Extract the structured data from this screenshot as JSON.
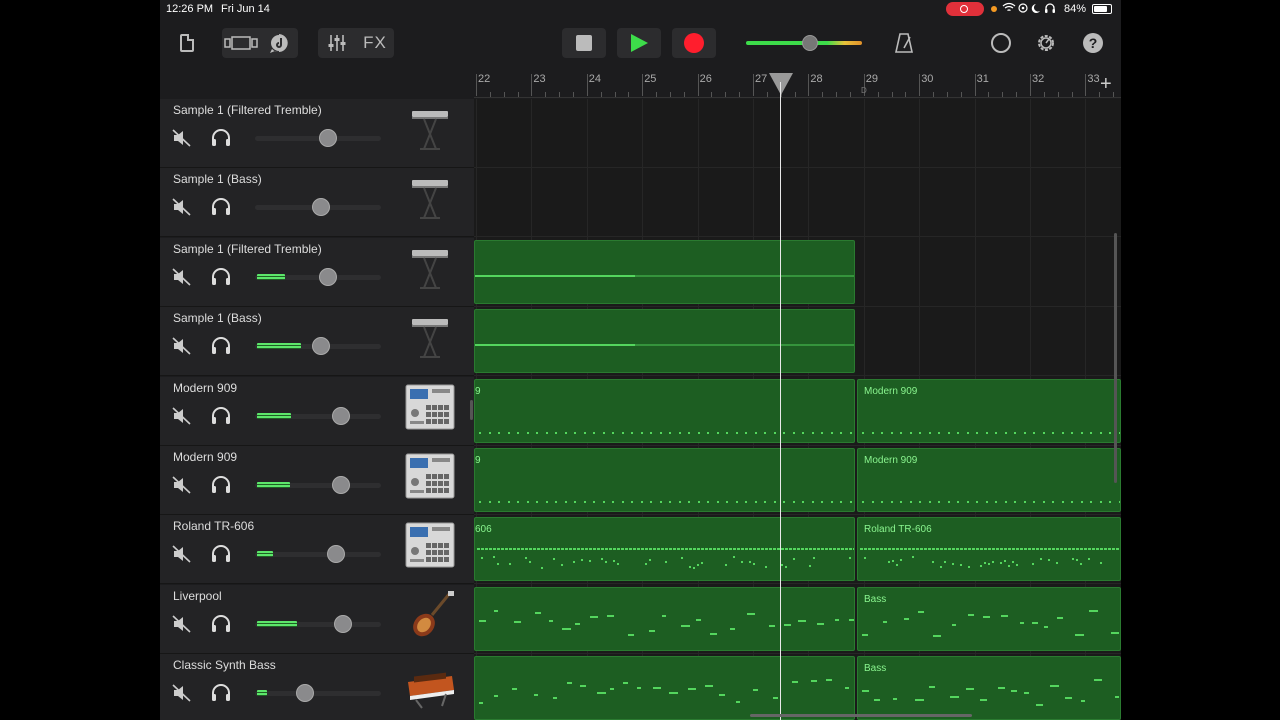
{
  "status_bar": {
    "time": "12:26 PM",
    "date": "Fri Jun 14",
    "battery": "84%",
    "icons": "wifi-icon location-icon moon-icon headphones-icon"
  },
  "toolbar": {
    "fx_label": "FX",
    "icons": [
      "document-icon",
      "view-toggle-icon",
      "loop-browser-icon",
      "mixer-icon",
      "fx-button",
      "stop-icon",
      "play-icon",
      "record-icon",
      "master-volume-slider",
      "metronome-icon",
      "chat-icon",
      "settings-icon",
      "help-icon"
    ],
    "help_label": "?",
    "master_volume": 0.55,
    "accent_colors": {
      "play": "#3ddc4a",
      "record": "#ff1e2d",
      "region": "#1d5e22"
    }
  },
  "ruler": {
    "bars": [
      "22",
      "23",
      "24",
      "25",
      "26",
      "27",
      "28",
      "29",
      "30",
      "31",
      "32",
      "33"
    ],
    "marker": "D",
    "add_label": "+"
  },
  "tracks": [
    {
      "name": "Sample 1 (Filtered Tremble)",
      "instrument": "keyboard-icon",
      "volume": 0.58,
      "level": 0
    },
    {
      "name": "Sample 1 (Bass)",
      "instrument": "keyboard-icon",
      "volume": 0.52,
      "level": 0
    },
    {
      "name": "Sample 1 (Filtered Tremble)",
      "instrument": "keyboard-icon",
      "volume": 0.58,
      "level": 0.22
    },
    {
      "name": "Sample 1 (Bass)",
      "instrument": "keyboard-icon",
      "volume": 0.52,
      "level": 0.35
    },
    {
      "name": "Modern 909",
      "instrument": "drum-machine-icon",
      "volume": 0.68,
      "level": 0.27
    },
    {
      "name": "Modern 909",
      "instrument": "drum-machine-icon",
      "volume": 0.68,
      "level": 0.26
    },
    {
      "name": "Roland TR-606",
      "instrument": "drum-machine-icon",
      "volume": 0.64,
      "level": 0.13
    },
    {
      "name": "Liverpool",
      "instrument": "bass-guitar-icon",
      "volume": 0.7,
      "level": 0.32
    },
    {
      "name": "Classic Synth Bass",
      "instrument": "synth-icon",
      "volume": 0.4,
      "level": 0.08
    }
  ],
  "regions": {
    "cut_labels": [
      "",
      "",
      "",
      "",
      "9",
      "9",
      "606",
      "",
      ""
    ],
    "second_labels": [
      "",
      "",
      "",
      "",
      "Modern 909",
      "Modern 909",
      "Roland TR-606",
      "Bass",
      "Bass"
    ]
  }
}
